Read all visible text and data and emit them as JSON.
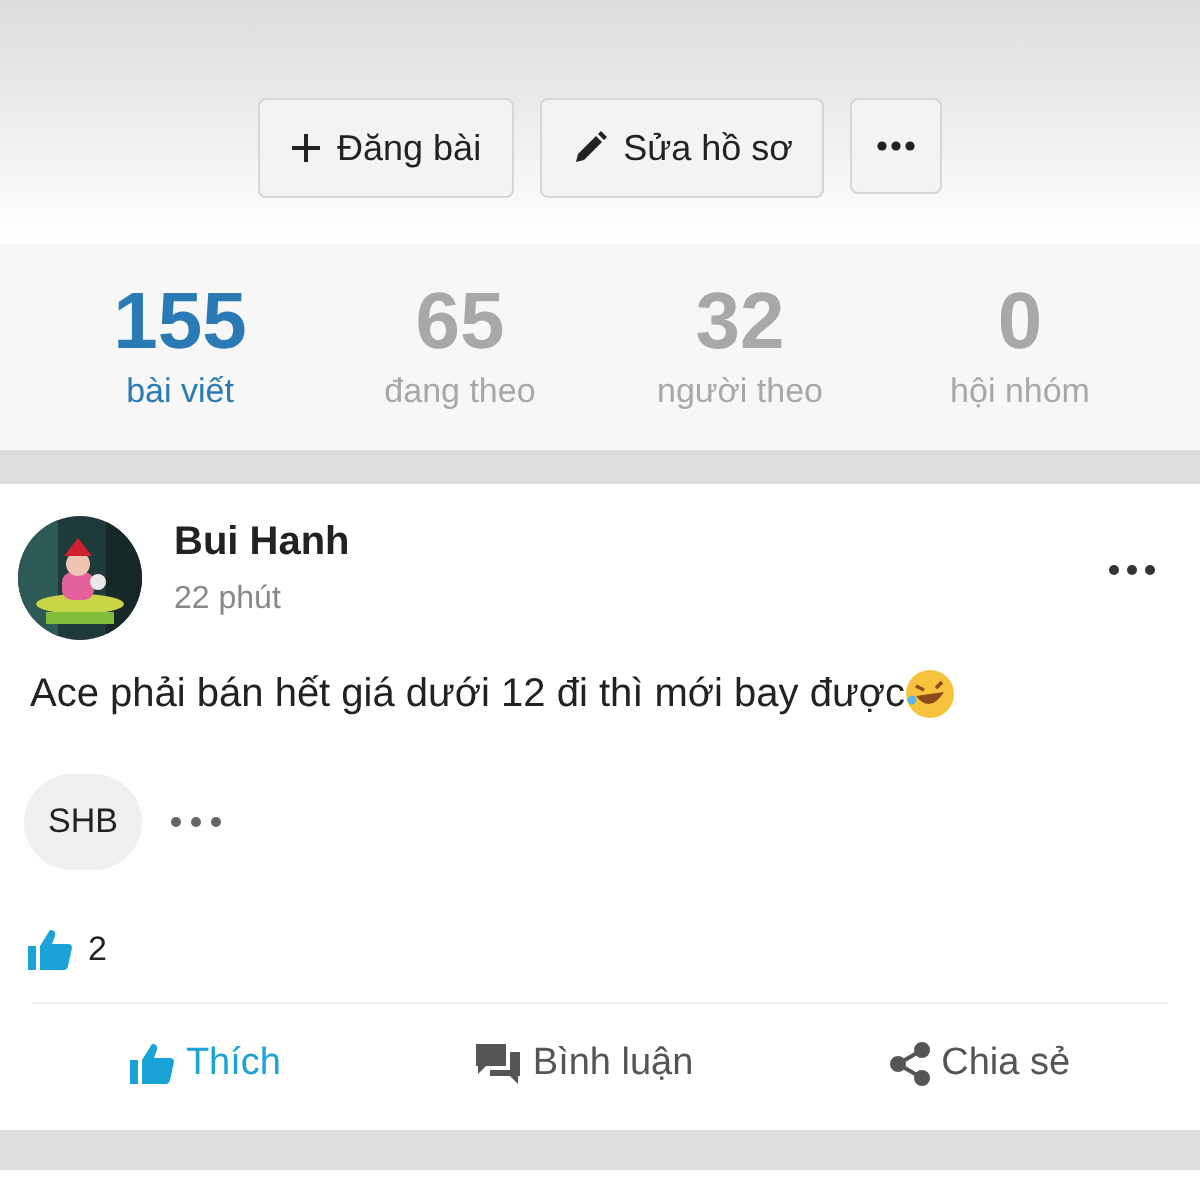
{
  "profile_actions": [
    {
      "kind": "plus",
      "label": "Đăng bài"
    },
    {
      "kind": "pencil",
      "label": "Sửa hồ sơ"
    },
    {
      "kind": "more"
    }
  ],
  "stats": [
    {
      "value": "155",
      "label": "bài viết",
      "selected": true
    },
    {
      "value": "65",
      "label": "đang theo",
      "selected": false
    },
    {
      "value": "32",
      "label": "người theo",
      "selected": false
    },
    {
      "value": "0",
      "label": "hội nhóm",
      "selected": false
    }
  ],
  "post": {
    "author": "Bui Hanh",
    "time": "22 phút",
    "text": "Ace phải bán hết giá dưới 12 đi thì mới bay được",
    "emoji": true,
    "tag": "SHB",
    "likes": "2",
    "actions": [
      {
        "kind": "like",
        "label": "Thích",
        "selected": true
      },
      {
        "kind": "comment",
        "label": "Bình luận",
        "selected": false
      },
      {
        "kind": "share",
        "label": "Chia sẻ",
        "selected": false
      }
    ]
  }
}
